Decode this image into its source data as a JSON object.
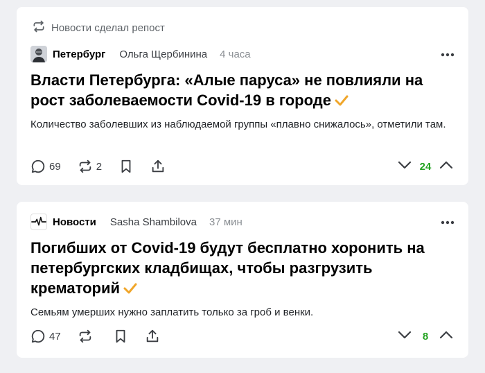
{
  "colors": {
    "background": "#eff0f3",
    "card": "#ffffff",
    "accent_check": "#f0a62a",
    "vote_green": "#24a322",
    "icon": "#3a3d42"
  },
  "posts": [
    {
      "repost_text": "Новости сделал репост",
      "channel": "Петербург",
      "author": "Ольга Щербинина",
      "time": "4 часа",
      "title": "Власти Петербурга: «Алые паруса» не повлияли на рост заболеваемости Covid-19 в городе",
      "snippet": "Количество заболевших из наблюдаемой группы «плавно снижалось», отметили там.",
      "comments": "69",
      "reposts": "2",
      "votes": "24",
      "verified": true,
      "icons": [
        "repost-icon",
        "avatar-portrait-icon",
        "more-icon",
        "comment-icon",
        "repost-icon",
        "bookmark-icon",
        "share-icon",
        "chevron-down-icon",
        "chevron-up-icon"
      ]
    },
    {
      "channel": "Новости",
      "author": "Sasha Shambilova",
      "time": "37 мин",
      "title": "Погибших от Covid-19 будут бесплатно хоронить на петербургских кладбищах, чтобы разгрузить крематорий",
      "snippet": "Семьям умерших нужно заплатить только за гроб и венки.",
      "comments": "47",
      "reposts": "",
      "votes": "8",
      "verified": true,
      "icons": [
        "pulse-logo-icon",
        "more-icon",
        "comment-icon",
        "repost-icon",
        "bookmark-icon",
        "share-icon",
        "chevron-down-icon",
        "chevron-up-icon"
      ]
    }
  ]
}
